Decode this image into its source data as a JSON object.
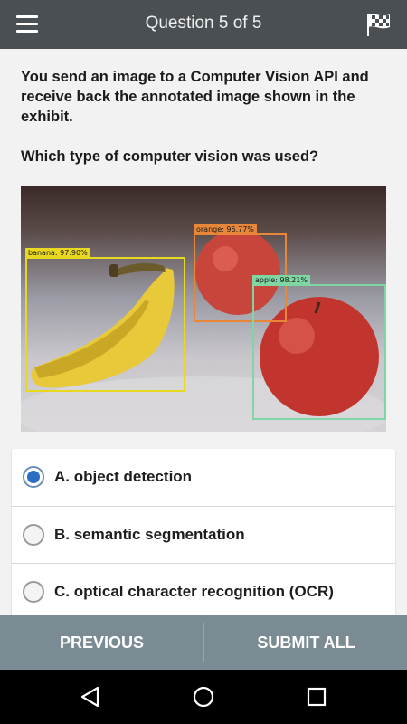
{
  "header": {
    "title": "Question 5 of 5",
    "menu_icon": "hamburger-menu-icon",
    "flag_icon": "checkered-flag-icon"
  },
  "question": {
    "text": "You send an image to a Computer Vision API and receive back the annotated image shown in the exhibit.",
    "prompt": "Which type of computer vision was used?"
  },
  "exhibit": {
    "labels": {
      "banana": "banana: 97.90%",
      "orange": "orange: 96.77%",
      "apple": "apple: 98.21%"
    },
    "colors": {
      "banana": "#e8d820",
      "orange": "#e8873a",
      "apple": "#7fd6a3"
    }
  },
  "answers": [
    {
      "label": "A. object detection",
      "selected": true
    },
    {
      "label": "B. semantic segmentation",
      "selected": false
    },
    {
      "label": "C. optical character recognition (OCR)",
      "selected": false
    }
  ],
  "footer": {
    "previous": "PREVIOUS",
    "submit": "SUBMIT ALL"
  },
  "system_nav": {
    "back_icon": "back-triangle-icon",
    "home_icon": "home-circle-icon",
    "recents_icon": "recents-square-icon"
  },
  "theme": {
    "header_bg": "#4a4f53",
    "footer_bg": "#7b8b93",
    "radio_selected": "#2a6fc4"
  }
}
